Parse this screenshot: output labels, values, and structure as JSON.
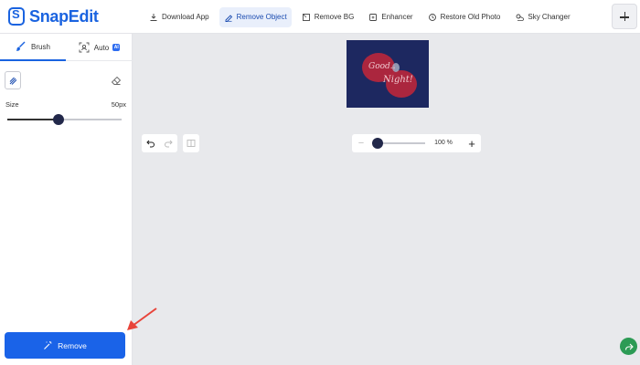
{
  "app": {
    "name": "SnapEdit",
    "brand_color": "#1a63e0"
  },
  "nav": {
    "items": [
      {
        "label": "Download App",
        "icon": "download-icon"
      },
      {
        "label": "Remove Object",
        "icon": "eraser-pen-icon",
        "active": true
      },
      {
        "label": "Remove BG",
        "icon": "remove-bg-icon"
      },
      {
        "label": "Enhancer",
        "icon": "enhancer-icon"
      },
      {
        "label": "Restore Old Photo",
        "icon": "restore-icon"
      },
      {
        "label": "Sky Changer",
        "icon": "sky-icon"
      }
    ],
    "add_icon": "plus-icon"
  },
  "panel": {
    "tabs": [
      {
        "label": "Brush",
        "icon": "brush-icon",
        "active": true
      },
      {
        "label": "Auto",
        "icon": "face-scan-icon",
        "badge": "AI"
      }
    ],
    "size_label": "Size",
    "size_value": "50px",
    "size_fraction": 0.45,
    "remove_label": "Remove",
    "remove_color": "#1a63e8"
  },
  "canvas": {
    "image_text_line1": "Good..",
    "image_text_line2": "Night!",
    "zoom_label": "100 %",
    "zoom_fraction": 0.0
  },
  "colors": {
    "accent": "#1a63e0",
    "canvas_bg": "#e8e9ec",
    "image_bg": "#1d2860",
    "blob": "#b3263c",
    "share": "#2c9b55",
    "arrow": "#e8443a"
  }
}
